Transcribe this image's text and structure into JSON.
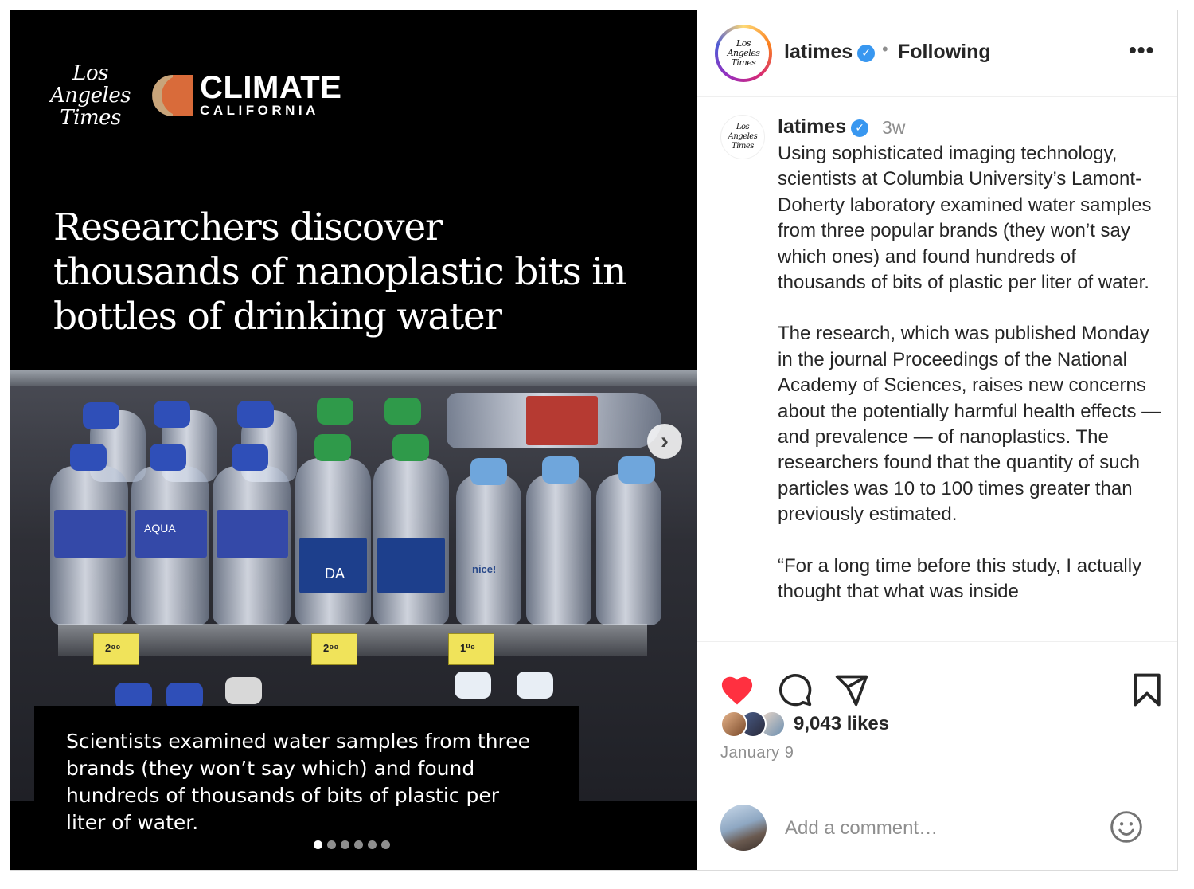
{
  "media": {
    "brand": {
      "logo_lines": [
        "Los",
        "Angeles",
        "Times"
      ],
      "section_title": "CLIMATE",
      "section_subtitle": "CALIFORNIA"
    },
    "headline": "Researchers discover thousands of nanoplastic bits in bottles of drinking water",
    "caption": "Scientists examined water samples from three brands (they won’t say which) and found hundreds of thousands of bits of plastic per liter of water.",
    "carousel": {
      "count": 6,
      "active_index": 0
    },
    "photo_text": {
      "tag_left": "2⁹⁹",
      "tag_mid": "2⁹⁹",
      "tag_right": "1⁰⁹",
      "aqua": "AQUA",
      "dasani": "DA",
      "nice": "nice!"
    }
  },
  "header": {
    "avatar_logo": [
      "Los",
      "Angeles",
      "Times"
    ],
    "username": "latimes",
    "verified_glyph": "✓",
    "separator": "•",
    "following_label": "Following",
    "more_glyph": "•••"
  },
  "post": {
    "username": "latimes",
    "time": "3w",
    "paragraphs": [
      "Using sophisticated imaging technology, scientists at Columbia University’s Lamont-Doherty laboratory examined water samples from three popular brands (they won’t say which ones) and found hundreds of thousands of bits of plastic per liter of water.",
      "The research, which was published Monday in the journal Proceedings of the National Academy of Sciences, raises new concerns about the potentially harmful health effects — and prevalence — of nanoplastics. The researchers found that the quantity of such particles was 10 to 100 times greater than previously estimated.",
      "“For a long time before this study, I actually thought that what was inside"
    ]
  },
  "actions": {
    "liked": true,
    "like_color": "#ff3040",
    "likes": "9,043 likes",
    "date": "January 9"
  },
  "comment_box": {
    "placeholder": "Add a comment…"
  }
}
